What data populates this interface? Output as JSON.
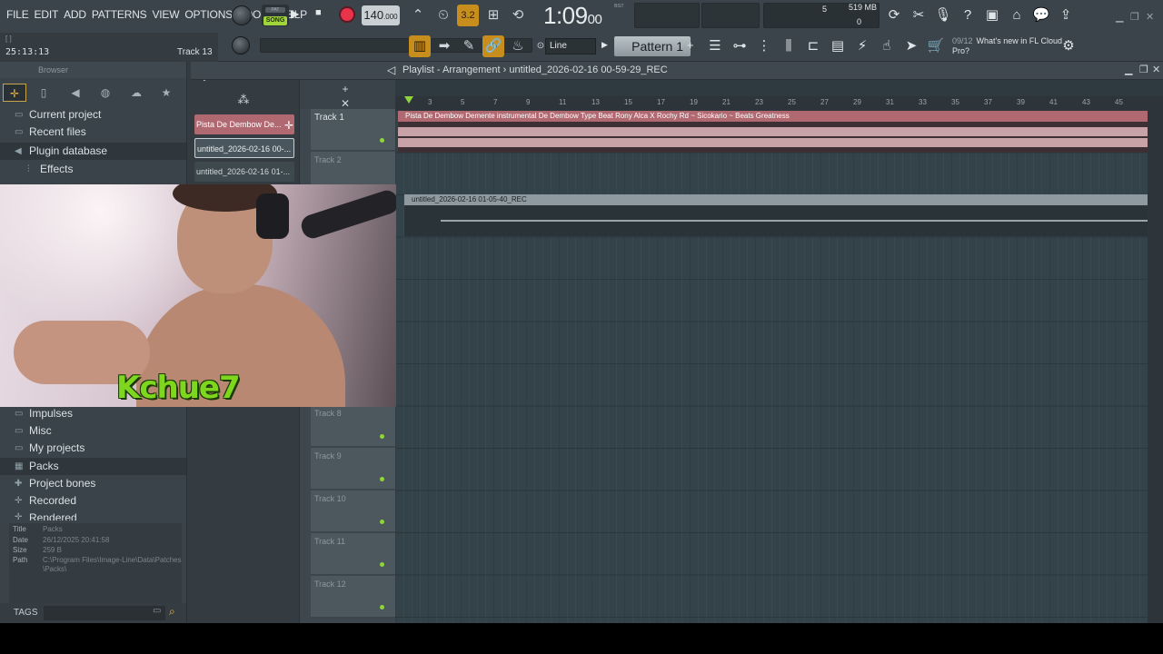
{
  "menu": [
    "FILE",
    "EDIT",
    "ADD",
    "PATTERNS",
    "VIEW",
    "OPTIONS",
    "TOOLS",
    "HELP"
  ],
  "hint": {
    "small": "[    ]",
    "time": "25:13:13",
    "track": "Track 13"
  },
  "transport": {
    "mode": "SONG",
    "tempo": "140",
    "tempo_decimals": ".000",
    "time_main": "1:09",
    "time_small": "00",
    "time_unit": "B:S:T",
    "step": "3.2"
  },
  "resources": {
    "cpu_value": "5",
    "memory": "519 MB",
    "polyphony": "0"
  },
  "snap": {
    "value": "Line"
  },
  "pattern": {
    "label": "Pattern 1"
  },
  "news": {
    "counter": "09/12",
    "text": "What's new in FL Cloud Pro?"
  },
  "browser": {
    "title": "Browser",
    "items_top": [
      {
        "label": "Current project",
        "icon": "folder-project-icon"
      },
      {
        "label": "Recent files",
        "icon": "folder-recent-icon"
      },
      {
        "label": "Plugin database",
        "icon": "plugin-icon"
      },
      {
        "label": "Effects",
        "icon": "effects-icon"
      }
    ],
    "items_bottom": [
      {
        "label": "Impulses",
        "icon": "folder-icon"
      },
      {
        "label": "Misc",
        "icon": "folder-icon"
      },
      {
        "label": "My projects",
        "icon": "folder-icon"
      },
      {
        "label": "Packs",
        "icon": "packs-icon"
      },
      {
        "label": "Project bones",
        "icon": "bones-icon"
      },
      {
        "label": "Recorded",
        "icon": "recorded-icon"
      },
      {
        "label": "Rendered",
        "icon": "rendered-icon"
      }
    ],
    "info": {
      "title_k": "Title",
      "title_v": "Packs",
      "date_k": "Date",
      "date_v": "26/12/2025 20:41:58",
      "size_k": "Size",
      "size_v": "259 B",
      "path_k": "Path",
      "path_v": "C:\\Program Files\\Image-Line\\Data\\Patches\\Packs\\"
    },
    "tags_label": "TAGS"
  },
  "picker": {
    "clips": [
      "Pista De Dembow De...",
      "untitled_2026-02-16 00-...",
      "untitled_2026-02-16 01-..."
    ]
  },
  "playlist": {
    "title": "Playlist - Arrangement",
    "breadcrumb": "untitled_2026-02-16 00-59-29_REC",
    "ruler": [
      "3",
      "5",
      "7",
      "9",
      "11",
      "13",
      "15",
      "17",
      "19",
      "21",
      "23",
      "25",
      "27",
      "29",
      "31",
      "33",
      "35",
      "37",
      "39",
      "41",
      "43",
      "45"
    ],
    "clip_a": "Pista De Dembow Demente instrumental De Dembow Type Beat Rony Alca X Rochy Rd ~ Sicokario ~ Beats Greatness",
    "clip_b": "untitled_2026-02-16 01-05-40_REC"
  },
  "tracks": [
    {
      "name": "Track 1"
    },
    {
      "name": "Track 2"
    },
    {
      "name": "Track 8"
    },
    {
      "name": "Track 9"
    },
    {
      "name": "Track 10"
    },
    {
      "name": "Track 11"
    },
    {
      "name": "Track 12"
    }
  ],
  "overlay": {
    "logo_text": "Kchue7"
  }
}
